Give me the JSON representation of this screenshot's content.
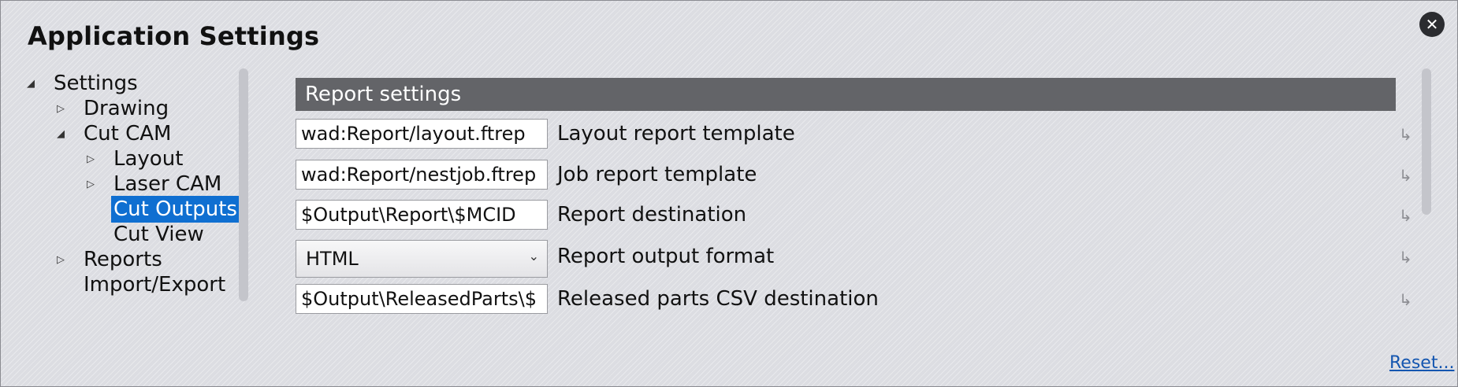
{
  "window": {
    "title": "Application Settings"
  },
  "icons": {
    "close": "close-icon",
    "row_reset": "reset-arrow-icon",
    "expanded": "triangle-expanded-icon",
    "collapsed": "triangle-collapsed-icon"
  },
  "colors": {
    "selection": "#0f6fd1",
    "header_bg": "#636468",
    "link": "#1456b0"
  },
  "tree": {
    "items": [
      {
        "label": "Settings",
        "level": 0,
        "state": "expanded",
        "selected": false
      },
      {
        "label": "Drawing",
        "level": 1,
        "state": "collapsed",
        "selected": false
      },
      {
        "label": "Cut CAM",
        "level": 1,
        "state": "expanded",
        "selected": false
      },
      {
        "label": "Layout",
        "level": 2,
        "state": "collapsed",
        "selected": false
      },
      {
        "label": "Laser CAM",
        "level": 2,
        "state": "collapsed",
        "selected": false
      },
      {
        "label": "Cut Outputs",
        "level": 2,
        "state": "none",
        "selected": true
      },
      {
        "label": "Cut View",
        "level": 2,
        "state": "none",
        "selected": false
      },
      {
        "label": "Reports",
        "level": 1,
        "state": "collapsed",
        "selected": false
      },
      {
        "label": "Import/Export",
        "level": 1,
        "state": "none",
        "selected": false
      }
    ]
  },
  "section": {
    "title": "Report settings"
  },
  "rows": [
    {
      "type": "text",
      "value": "wad:Report/layout.ftrep",
      "label": "Layout report template"
    },
    {
      "type": "text",
      "value": "wad:Report/nestjob.ftrep",
      "label": "Job report template"
    },
    {
      "type": "text",
      "value": "$Output\\Report\\$MCID",
      "label": "Report destination"
    },
    {
      "type": "select",
      "value": "HTML",
      "label": "Report output format"
    },
    {
      "type": "text",
      "value": "$Output\\ReleasedParts\\$",
      "label": "Released parts CSV destination"
    }
  ],
  "footer": {
    "reset_label": "Reset..."
  }
}
